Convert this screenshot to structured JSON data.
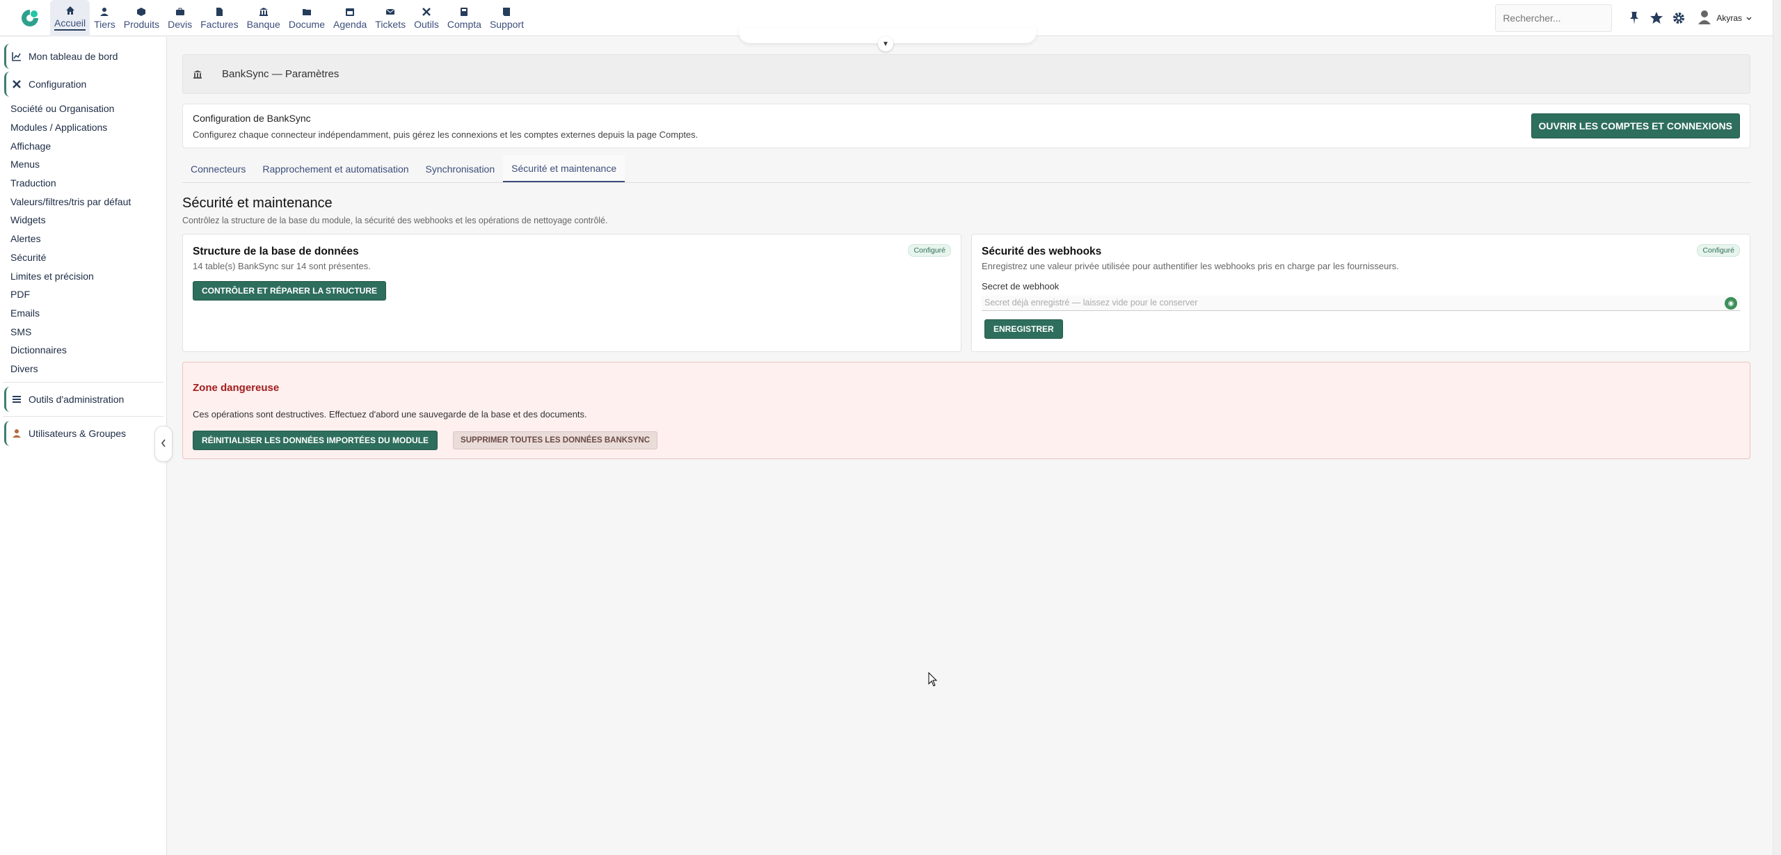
{
  "topbar": {
    "menus": [
      {
        "label": "Accueil",
        "icon": "home-icon",
        "active": true
      },
      {
        "label": "Tiers",
        "icon": "user-icon"
      },
      {
        "label": "Produits",
        "icon": "cube-icon"
      },
      {
        "label": "Devis",
        "icon": "briefcase-icon"
      },
      {
        "label": "Factures",
        "icon": "invoice-icon"
      },
      {
        "label": "Banque",
        "icon": "bank-icon"
      },
      {
        "label": "Docume",
        "icon": "folder-icon"
      },
      {
        "label": "Agenda",
        "icon": "calendar-icon"
      },
      {
        "label": "Tickets",
        "icon": "ticket-icon"
      },
      {
        "label": "Outils",
        "icon": "tools-icon"
      },
      {
        "label": "Compta",
        "icon": "ledger-icon"
      },
      {
        "label": "Support",
        "icon": "book-icon"
      }
    ],
    "search_placeholder": "Rechercher...",
    "user_name": "Akyras"
  },
  "sidebar": {
    "dashboard": "Mon tableau de bord",
    "configuration": "Configuration",
    "items": [
      "Société ou Organisation",
      "Modules / Applications",
      "Affichage",
      "Menus",
      "Traduction",
      "Valeurs/filtres/tris par défaut",
      "Widgets",
      "Alertes",
      "Sécurité",
      "Limites et précision",
      "PDF",
      "Emails",
      "SMS",
      "Dictionnaires",
      "Divers"
    ],
    "admin_tools": "Outils d'administration",
    "users_groups": "Utilisateurs & Groupes"
  },
  "page": {
    "title": "BankSync — Paramètres",
    "config_title": "Configuration de BankSync",
    "config_desc": "Configurez chaque connecteur indépendamment, puis gérez les connexions et les comptes externes depuis la page Comptes.",
    "open_accounts_button": "Ouvrir les comptes et connexions",
    "tabs": [
      "Connecteurs",
      "Rapprochement et automatisation",
      "Synchronisation",
      "Sécurité et maintenance"
    ],
    "active_tab": 3,
    "section_title": "Sécurité et maintenance",
    "section_desc": "Contrôlez la structure de la base du module, la sécurité des webhooks et les opérations de nettoyage contrôlé.",
    "db_card": {
      "title": "Structure de la base de données",
      "desc": "14 table(s) BankSync sur 14 sont présentes.",
      "badge": "Configuré",
      "button": "Contrôler et réparer la structure"
    },
    "webhook_card": {
      "title": "Sécurité des webhooks",
      "desc": "Enregistrez une valeur privée utilisée pour authentifier les webhooks pris en charge par les fournisseurs.",
      "badge": "Configuré",
      "field_label": "Secret de webhook",
      "field_placeholder": "Secret déjà enregistré — laissez vide pour le conserver",
      "button": "Enregistrer"
    },
    "danger": {
      "title": "Zone dangereuse",
      "desc": "Ces opérations sont destructives. Effectuez d'abord une sauvegarde de la base et des documents.",
      "reset_button": "Réinitialiser les données importées du module",
      "delete_button": "Supprimer toutes les données BankSync"
    }
  },
  "colors": {
    "accent_green": "#2e6e5c",
    "nav_blue": "#3c4e7a",
    "danger_red": "#a21d1d",
    "danger_bg": "#fdf0ef"
  }
}
